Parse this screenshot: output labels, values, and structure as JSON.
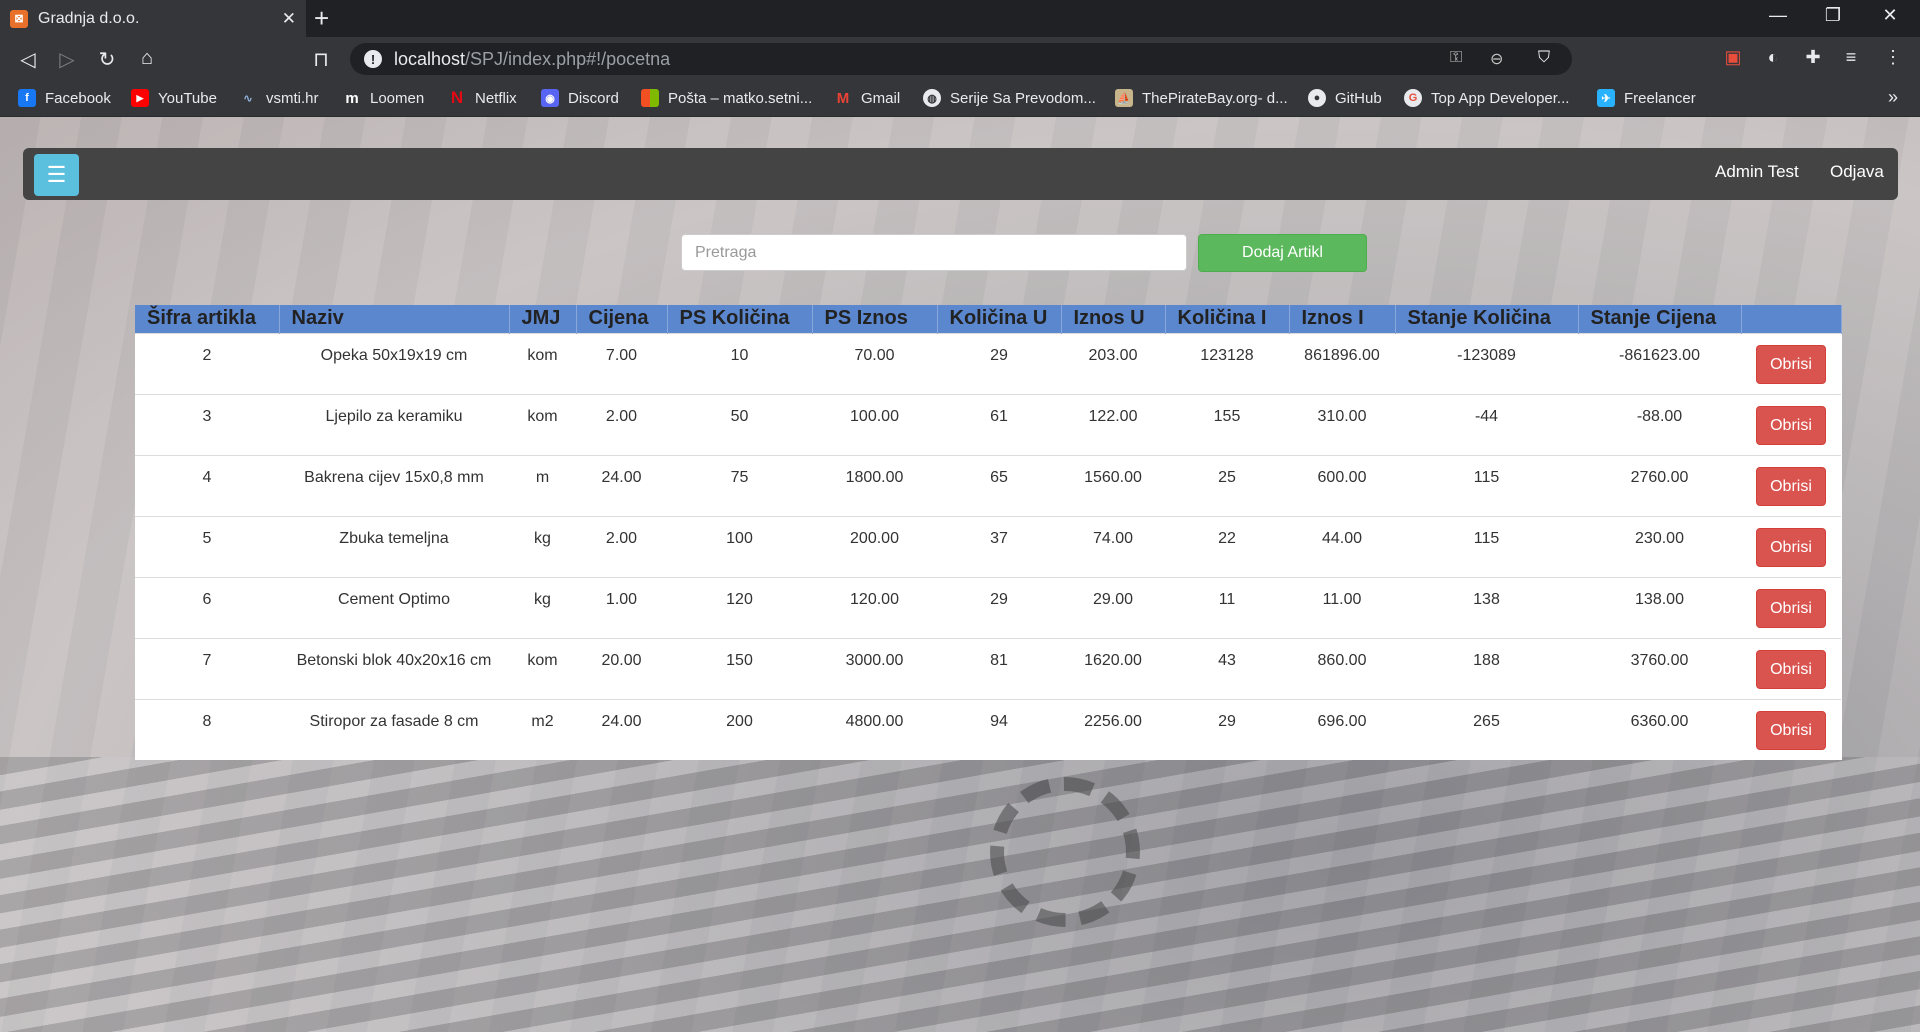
{
  "browser": {
    "tab": {
      "title": "Gradnja d.o.o.",
      "favicon": "xampp-icon"
    },
    "url": {
      "host": "localhost",
      "path": "/SPJ/index.php#!/pocetna"
    },
    "bookmarks": [
      {
        "label": "Facebook",
        "icon": "facebook-icon",
        "color": "#1877f2",
        "glyph": "f"
      },
      {
        "label": "YouTube",
        "icon": "youtube-icon",
        "color": "#ff0000",
        "glyph": "▶"
      },
      {
        "label": "vsmti.hr",
        "icon": "vsmti-icon",
        "color": "#4a6fa5",
        "glyph": "∿"
      },
      {
        "label": "Loomen",
        "icon": "loomen-icon",
        "color": "#35363a",
        "glyph": "m"
      },
      {
        "label": "Netflix",
        "icon": "netflix-icon",
        "color": "#e50914",
        "glyph": "N"
      },
      {
        "label": "Discord",
        "icon": "discord-icon",
        "color": "#5865f2",
        "glyph": "◉"
      },
      {
        "label": "Pošta – matko.setni...",
        "icon": "microsoft-icon",
        "color": "#f25022",
        "glyph": "▦"
      },
      {
        "label": "Gmail",
        "icon": "gmail-icon",
        "color": "#ea4335",
        "glyph": "M"
      },
      {
        "label": "Serije Sa Prevodom...",
        "icon": "globe-icon",
        "color": "#9aa0a6",
        "glyph": "◍"
      },
      {
        "label": "ThePirateBay.org- d...",
        "icon": "piratebay-icon",
        "color": "#c8b48a",
        "glyph": "⛵"
      },
      {
        "label": "GitHub",
        "icon": "github-icon",
        "color": "#4a4a4a",
        "glyph": "●"
      },
      {
        "label": "Top App Developer...",
        "icon": "topapp-icon",
        "color": "#e94e3c",
        "glyph": "G"
      },
      {
        "label": "Freelancer",
        "icon": "freelancer-icon",
        "color": "#29b2fe",
        "glyph": "✈"
      }
    ]
  },
  "appbar": {
    "user": "Admin Test",
    "logout": "Odjava"
  },
  "search": {
    "placeholder": "Pretraga"
  },
  "add_button": "Dodaj Artikl",
  "table": {
    "headers": [
      "Šifra artikla",
      "Naziv",
      "JMJ",
      "Cijena",
      "PS Količina",
      "PS Iznos",
      "Količina U",
      "Iznos U",
      "Količina I",
      "Iznos I",
      "Stanje Količina",
      "Stanje Cijena",
      ""
    ],
    "delete_label": "Obrisi",
    "rows": [
      [
        "2",
        "Opeka 50x19x19 cm",
        "kom",
        "7.00",
        "10",
        "70.00",
        "29",
        "203.00",
        "123128",
        "861896.00",
        "-123089",
        "-861623.00"
      ],
      [
        "3",
        "Ljepilo za keramiku",
        "kom",
        "2.00",
        "50",
        "100.00",
        "61",
        "122.00",
        "155",
        "310.00",
        "-44",
        "-88.00"
      ],
      [
        "4",
        "Bakrena cijev 15x0,8 mm",
        "m",
        "24.00",
        "75",
        "1800.00",
        "65",
        "1560.00",
        "25",
        "600.00",
        "115",
        "2760.00"
      ],
      [
        "5",
        "Zbuka temeljna",
        "kg",
        "2.00",
        "100",
        "200.00",
        "37",
        "74.00",
        "22",
        "44.00",
        "115",
        "230.00"
      ],
      [
        "6",
        "Cement Optimo",
        "kg",
        "1.00",
        "120",
        "120.00",
        "29",
        "29.00",
        "11",
        "11.00",
        "138",
        "138.00"
      ],
      [
        "7",
        "Betonski blok 40x20x16 cm",
        "kom",
        "20.00",
        "150",
        "3000.00",
        "81",
        "1620.00",
        "43",
        "860.00",
        "188",
        "3760.00"
      ],
      [
        "8",
        "Stiropor za fasade 8 cm",
        "m2",
        "24.00",
        "200",
        "4800.00",
        "94",
        "2256.00",
        "29",
        "696.00",
        "265",
        "6360.00"
      ]
    ]
  }
}
